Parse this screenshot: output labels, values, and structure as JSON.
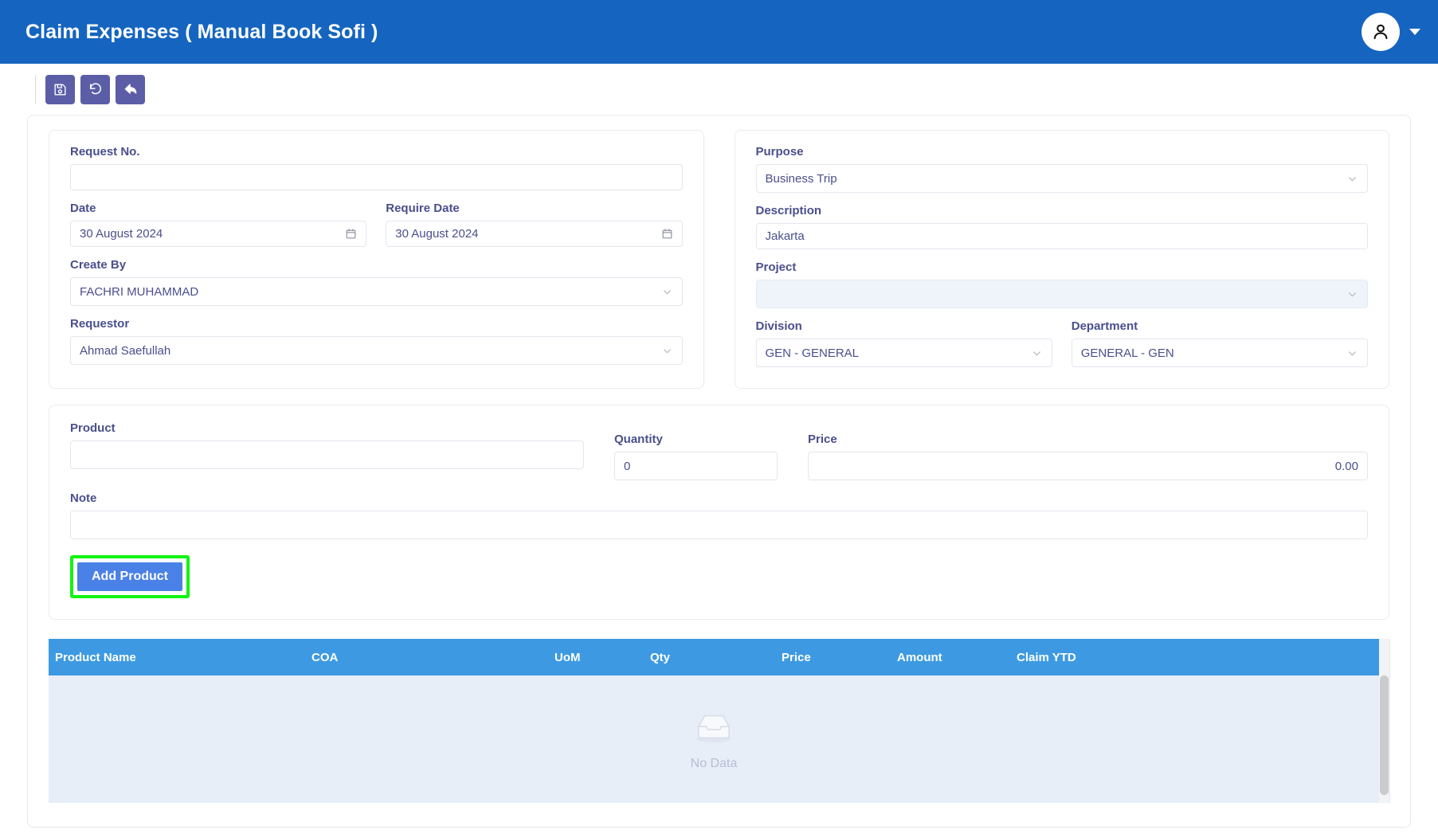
{
  "appbar": {
    "title": "Claim Expenses ( Manual Book Sofi )",
    "avatar_icon": "user-icon",
    "caret_icon": "chevron-down-icon"
  },
  "toolbar": {
    "buttons": [
      {
        "name": "save-button",
        "icon": "save-floppy-icon"
      },
      {
        "name": "reset-button",
        "icon": "refresh-counterclockwise-icon"
      },
      {
        "name": "back-button",
        "icon": "arrow-back-icon"
      }
    ]
  },
  "left_panel": {
    "request_no": {
      "label": "Request No.",
      "value": ""
    },
    "date": {
      "label": "Date",
      "value": "30 August 2024",
      "icon": "calendar-icon"
    },
    "require_date": {
      "label": "Require Date",
      "value": "30 August 2024",
      "icon": "calendar-icon"
    },
    "create_by": {
      "label": "Create By",
      "value": "FACHRI MUHAMMAD",
      "icon": "chevron-down-icon"
    },
    "requestor": {
      "label": "Requestor",
      "value": "Ahmad Saefullah",
      "icon": "chevron-down-icon"
    }
  },
  "right_panel": {
    "purpose": {
      "label": "Purpose",
      "value": "Business Trip",
      "icon": "chevron-down-icon"
    },
    "description": {
      "label": "Description",
      "value": "Jakarta"
    },
    "project": {
      "label": "Project",
      "value": "",
      "icon": "chevron-down-icon"
    },
    "division": {
      "label": "Division",
      "value": "GEN - GENERAL",
      "icon": "chevron-down-icon"
    },
    "department": {
      "label": "Department",
      "value": "GENERAL - GEN",
      "icon": "chevron-down-icon"
    }
  },
  "product_panel": {
    "product": {
      "label": "Product",
      "value": ""
    },
    "quantity": {
      "label": "Quantity",
      "value": "0"
    },
    "price": {
      "label": "Price",
      "value": "0.00"
    },
    "note": {
      "label": "Note",
      "value": ""
    },
    "add_product_label": "Add Product"
  },
  "table": {
    "headers": [
      "Product Name",
      "COA",
      "UoM",
      "Qty",
      "Price",
      "Amount",
      "Claim YTD"
    ],
    "rows": [],
    "empty_label": "No Data",
    "empty_icon": "inbox-empty-icon"
  },
  "colors": {
    "appbar_blue": "#1565C0",
    "toolbar_purple": "#5B5EA6",
    "table_header_blue": "#3d9ae2",
    "label_indigo": "#4a4f8c",
    "add_button_blue": "#4a81e6",
    "highlight_green": "#12F312",
    "empty_bg": "#e7eef8"
  }
}
